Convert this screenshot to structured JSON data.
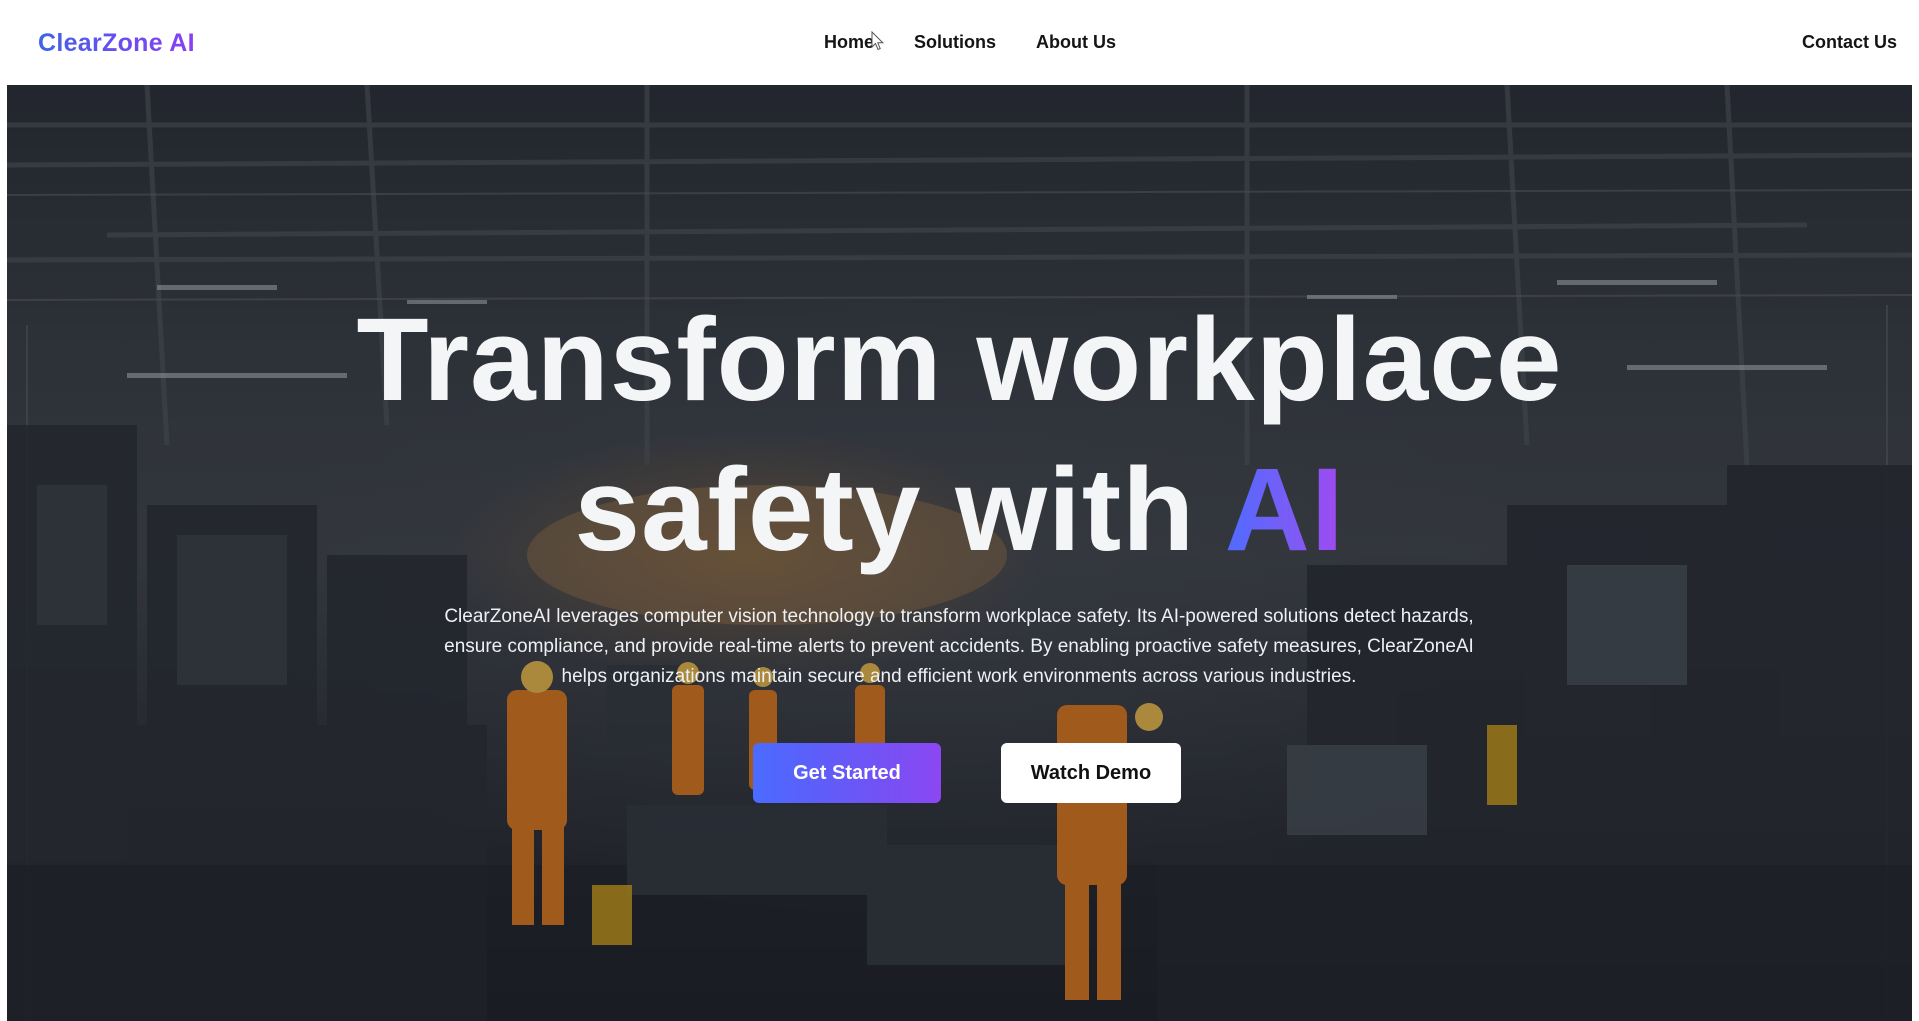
{
  "brand": {
    "logo_text": "ClearZone AI"
  },
  "nav": {
    "links": [
      {
        "label": "Home"
      },
      {
        "label": "Solutions"
      },
      {
        "label": "About Us"
      }
    ],
    "contact_label": "Contact Us"
  },
  "hero": {
    "title_line1": "Transform workplace",
    "title_line2_prefix": "safety with ",
    "title_highlight": "AI",
    "description": "ClearZoneAI leverages computer vision technology to transform workplace safety. Its AI-powered solutions detect hazards, ensure compliance, and provide real-time alerts to prevent accidents. By enabling proactive safety measures, ClearZoneAI helps organizations maintain secure and efficient work environments across various industries.",
    "primary_button": "Get Started",
    "secondary_button": "Watch Demo",
    "background_image": "factory-floor-workers-photo"
  },
  "colors": {
    "brand_gradient_start": "#3f63e6",
    "brand_gradient_end": "#8a3ff0",
    "nav_text": "#151515",
    "hero_text": "#f4f5f7"
  }
}
